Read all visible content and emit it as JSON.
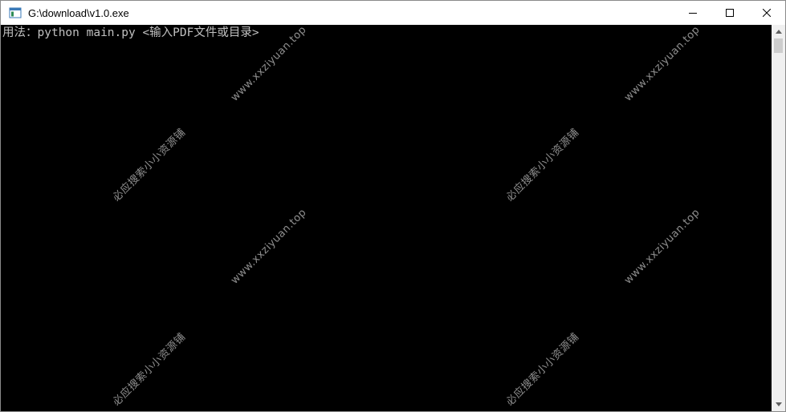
{
  "window": {
    "title": "G:\\download\\v1.0.exe",
    "icon": "console-app-icon"
  },
  "controls": {
    "minimize": "minimize-icon",
    "maximize": "maximize-icon",
    "close": "close-icon"
  },
  "console": {
    "lines": [
      "用法：python main.py <输入PDF文件或目录>"
    ],
    "text_color": "#c0c0c0",
    "background": "#000000"
  },
  "watermarks": {
    "site": "www.xxziyuan.top",
    "cn": "必应搜索小小资源铺"
  }
}
